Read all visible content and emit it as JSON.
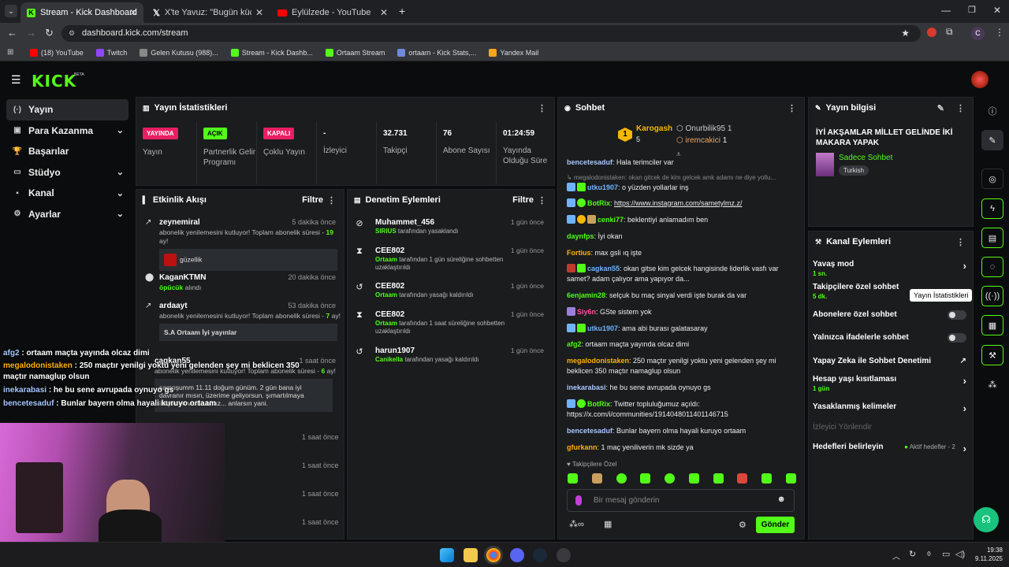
{
  "browser": {
    "tabs": [
      {
        "title": "Stream - Kick Dashboard",
        "active": true
      },
      {
        "title": "X'te Yavuz: \"Bugün küçük bir ya"
      },
      {
        "title": "Eylülzede - YouTube"
      }
    ],
    "url": "dashboard.kick.com/stream",
    "bookmarks": [
      "(18) YouTube",
      "Twitch",
      "Gelen Kutusu (988)...",
      "Stream - Kick Dashb...",
      "Ortaam Stream",
      "ortaam - Kick Stats,...",
      "Yandex Mail"
    ],
    "profile_initial": "C"
  },
  "kick": {
    "logo": "KICK",
    "beta": "BETA"
  },
  "nav": [
    {
      "label": "Yayın",
      "icon": "(·)"
    },
    {
      "label": "Para Kazanma",
      "icon": "▣",
      "chev": "⌄"
    },
    {
      "label": "Başarılar",
      "icon": "🏆"
    },
    {
      "label": "Stüdyo",
      "icon": "▭",
      "chev": "⌄"
    },
    {
      "label": "Kanal",
      "icon": "▪",
      "chev": "⌄"
    },
    {
      "label": "Ayarlar",
      "icon": "⚙",
      "chev": "⌄"
    }
  ],
  "stats": {
    "title": "Yayın İstatistikleri",
    "cols": [
      {
        "badge": "YAYINDA",
        "badge_color": "#e91e63",
        "label": "Yayın"
      },
      {
        "badge": "AÇIK",
        "badge_color": "#53fc18",
        "label": "Partnerlik Gelir Programı"
      },
      {
        "badge": "KAPALI",
        "badge_color": "#e91e63",
        "label": "Çoklu Yayın"
      },
      {
        "value": "-",
        "label": "İzleyici"
      },
      {
        "value": "32.731",
        "label": "Takipçi"
      },
      {
        "value": "76",
        "label": "Abone Sayısı"
      },
      {
        "value": "01:24:59",
        "label": "Yayında Olduğu Süre"
      }
    ]
  },
  "activity": {
    "title": "Etkinlik Akışı",
    "filter": "Filtre",
    "events": [
      {
        "name": "zeynemiral",
        "time": "5 dakika önce",
        "desc": "abonelik yenilemesini kutluyor! Toplam abonelik süresi - ",
        "hl": "19",
        "tail": " ay!",
        "box": "güzellik"
      },
      {
        "name": "KaganKTMN",
        "time": "20 dakika önce",
        "hl": "öpücük",
        "tail": " alındı"
      },
      {
        "name": "ardaayt",
        "time": "53 dakika önce",
        "desc": "abonelik yenilemesini kutluyor! Toplam abonelik süresi - ",
        "hl": "7",
        "tail": " ay!",
        "box": "S.A Ortaam İyi yayınlar"
      },
      {
        "name": "cagkan55",
        "time": "1 saat önce",
        "desc": "abonelik yenilemesini kutluyor! Toplam abonelik süresi - ",
        "hl": "6",
        "tail": " ay!",
        "box": "samoşumm 11.11 doğum günüm. 2 gün bana iyi davranır mısın, üzerime geliyorsun. şımartılmaya ihtiyacım varda biraz... anlarsın yani."
      }
    ],
    "extra_times": [
      "1 saat önce",
      "1 saat önce",
      "1 saat önce",
      "1 saat önce"
    ]
  },
  "moderation": {
    "title": "Denetim Eylemleri",
    "filter": "Filtre",
    "items": [
      {
        "icon": "⊘",
        "name": "Muhammet_456",
        "time": "1 gün önce",
        "who": "SIRIUS",
        "desc": " tarafından yasaklandı"
      },
      {
        "icon": "⧗",
        "name": "CEE802",
        "time": "1 gün önce",
        "who": "Ortaam",
        "desc": " tarafından 1 gün süreliğine sohbetten uzaklaştırıldı"
      },
      {
        "icon": "↺",
        "name": "CEE802",
        "time": "1 gün önce",
        "who": "Ortaam",
        "desc": " tarafından yasağı kaldırıldı"
      },
      {
        "icon": "⧗",
        "name": "CEE802",
        "time": "1 gün önce",
        "who": "Ortaam",
        "desc": " tarafından 1 saat süreliğine sohbetten uzaklaştırıldı"
      },
      {
        "icon": "↺",
        "name": "harun1907",
        "time": "1 gün önce",
        "who": "Canikella",
        "desc": " tarafından yasağı kaldırıldı"
      }
    ]
  },
  "chat": {
    "title": "Sohbet",
    "top": [
      {
        "name": "Karogash",
        "count": "5"
      },
      {
        "name": "Onurbilik95",
        "count": "1"
      },
      {
        "name": "iremcakici",
        "count": "1"
      }
    ],
    "rank": "1",
    "messages": [
      {
        "user": "bencetesaduf",
        "color": "#a7c7ff",
        "text": "Hala terimciler var"
      },
      {
        "user": "megalodonistaken",
        "color": "#999",
        "text": "okan gitcek de kim gelcek amk adamı ne diye yollu..."
      },
      {
        "user": "utku1907",
        "color": "#6fb3ff",
        "text": "o yüzden yollarlar inş"
      },
      {
        "user": "BotRix",
        "color": "#53fc18",
        "text": "https://www.instagram.com/sametylmz.z/",
        "link": true
      },
      {
        "user": "cenki77",
        "color": "#53fc18",
        "text": "beklentiyi anlamadım ben"
      },
      {
        "user": "daynfps",
        "color": "#53fc18",
        "text": "İyi okan"
      },
      {
        "user": "Fortius",
        "color": "#ffb300",
        "text": "max gsli ıq işte"
      },
      {
        "user": "cagkan55",
        "color": "#6fb3ff",
        "text": "okan gitse kim gelcek hangisinde liderlik vasfı var samet? adam çalıyor ama yapıyor da..."
      },
      {
        "user": "6enjamin28",
        "color": "#53fc18",
        "text": "selçuk bu maç sinyal verdi işte burak da var"
      },
      {
        "user": "Siy6n",
        "color": "#ff4fa3",
        "text": "GSte sistem yok"
      },
      {
        "user": "utku1907",
        "color": "#6fb3ff",
        "text": "ama abi burası galatasaray"
      },
      {
        "user": "afg2",
        "color": "#53fc18",
        "text": "ortaam maçta yayında olcaz dimi"
      },
      {
        "user": "megalodonistaken",
        "color": "#ffb300",
        "text": "250 maçtır yenilgi yoktu yeni gelenden şey mi beklicen 350 maçtır namaglup olsun"
      },
      {
        "user": "inekarabasi",
        "color": "#a7c7ff",
        "text": "he bu sene avrupada oynuyo gs"
      },
      {
        "user": "BotRix",
        "color": "#53fc18",
        "text": "Twitter topluluğumuz açıldı: https://x.com/i/communities/1914048011401146715"
      },
      {
        "user": "bencetesaduf",
        "color": "#a7c7ff",
        "text": "Bunlar bayern olma hayali kuruyo ortaam"
      },
      {
        "user": "gfurkann",
        "color": "#ffb300",
        "text": "1 maç yeniliverin mk sizde ya"
      }
    ],
    "followers_only": "Takipçilere Özel",
    "placeholder": "Bir mesaj gönderin",
    "send": "Gönder"
  },
  "info": {
    "title": "Yayın bilgisi",
    "stream_title": "İYİ AKŞAMLAR MİLLET GELİNDE İKİ MAKARA YAPAK",
    "category": "Sadece Sohbet",
    "language": "Turkish"
  },
  "channel": {
    "title": "Kanal Eylemleri",
    "items": [
      {
        "label": "Yavaş mod",
        "sub": "1 sn."
      },
      {
        "label": "Takipçilere özel sohbet",
        "sub": "5 dk."
      },
      {
        "label": "Abonelere özel sohbet",
        "toggle": true
      },
      {
        "label": "Yalnızca ifadelerle sohbet",
        "toggle": true
      },
      {
        "label": "Yapay Zeka ile Sohbet Denetimi"
      },
      {
        "label": "Hesap yaşı kısıtlaması",
        "sub": "1 gün"
      },
      {
        "label": "Yasaklanmış kelimeler"
      },
      {
        "label": "İzleyici Yönlendir",
        "disabled": true
      },
      {
        "label": "Hedefleri belirleyin",
        "aside": "Aktif hedefler - 2"
      }
    ]
  },
  "tooltip": "Yayın İstatistikleri",
  "overlay": [
    {
      "user": "afg2",
      "color": "#a7c7ff",
      "text": " : ortaam maçta yayında olcaz dimi"
    },
    {
      "user": "megalodonistaken",
      "color": "#ffb300",
      "text": " : 250 maçtır yenilgi yoktu yeni gelenden şey mi beklicen 350"
    },
    {
      "user": "",
      "color": "#fff",
      "text": "maçtır namaglup olsun"
    },
    {
      "user": "inekarabasi",
      "color": "#a7c7ff",
      "text": " : he bu sene avrupada oynuyo gs"
    },
    {
      "user": "bencetesaduf",
      "color": "#a7c7ff",
      "text": " : Bunlar bayern olma hayali kuruyo ortaam"
    }
  ],
  "clock": {
    "time": "19:38",
    "date": "9.11.2025"
  }
}
